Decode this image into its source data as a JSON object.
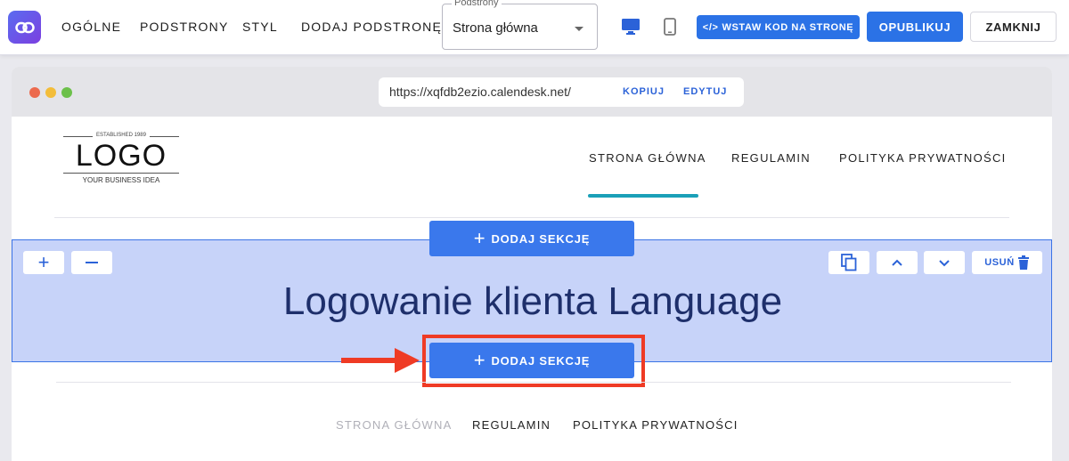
{
  "topbar": {
    "logo_icon": "link-icon",
    "nav": [
      "OGÓLNE",
      "PODSTRONY",
      "STYL",
      "DODAJ PODSTRONĘ"
    ],
    "select_label": "Podstrony",
    "select_value": "Strona główna",
    "desktop_icon": "monitor-icon",
    "mobile_icon": "phone-icon",
    "embed_label": "WSTAW KOD NA STRONĘ",
    "publish_label": "OPUBLIKUJ",
    "close_label": "ZAMKNIJ",
    "accent": "#2b72e6"
  },
  "browser": {
    "url": "https://xqfdb2ezio.calendesk.net/",
    "copy_label": "KOPIUJ",
    "edit_label": "EDYTUJ"
  },
  "site": {
    "logo": {
      "established": "ESTABLISHED 1989",
      "text": "LOGO",
      "tagline": "YOUR BUSINESS IDEA"
    },
    "nav": [
      "STRONA GŁÓWNA",
      "REGULAMIN",
      "POLITYKA PRYWATNOŚCI"
    ],
    "active_nav_color": "#1aa0b8"
  },
  "section": {
    "title": "Logowanie klienta Language",
    "add_section_label": "DODAJ SEKCJĘ",
    "delete_label": "USUŃ",
    "selection_color": "#c7d3f9"
  },
  "footer": {
    "nav": [
      "STRONA GŁÓWNA",
      "REGULAMIN",
      "POLITYKA PRYWATNOŚCI"
    ]
  },
  "annotation_color": "#ef3b25"
}
